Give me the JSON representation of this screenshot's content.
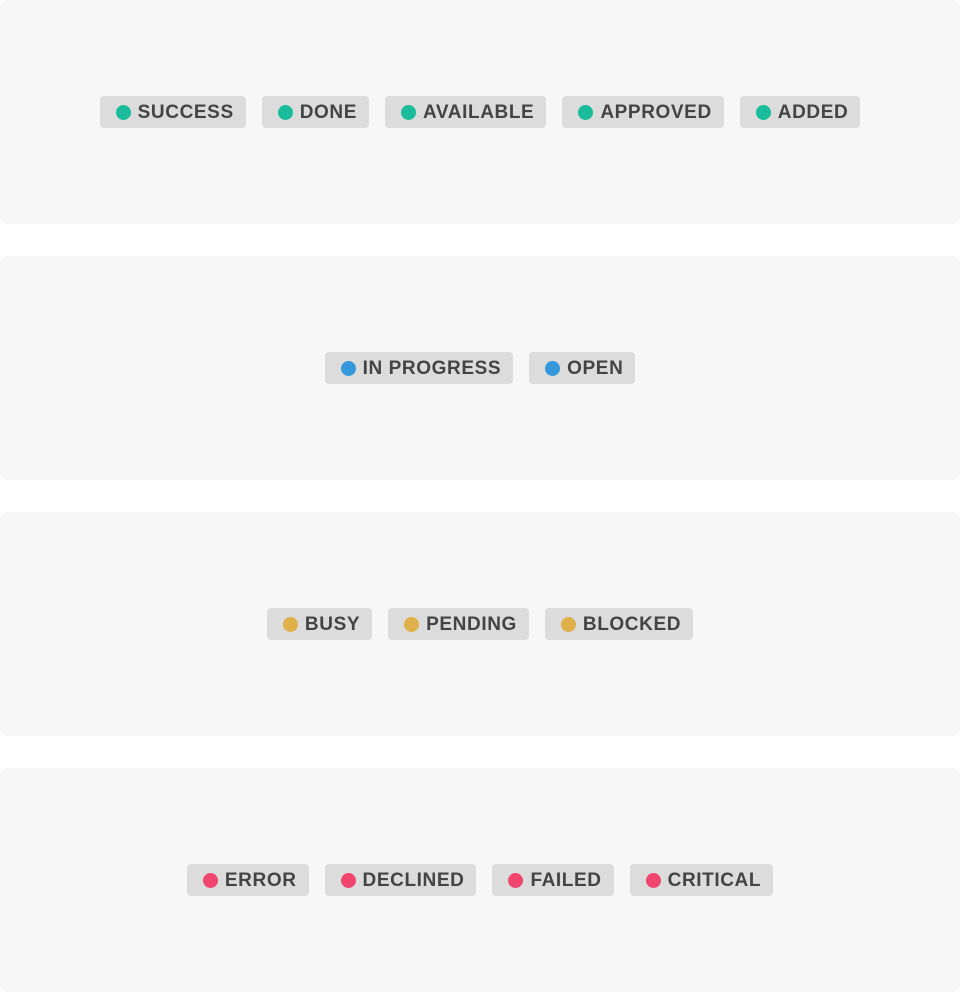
{
  "colors": {
    "success": "#1abc9c",
    "info": "#3498db",
    "warning": "#e0b04a",
    "danger": "#f0456f",
    "badge_background": "#dcdcdc",
    "panel_background": "#f7f7f7",
    "label_text": "#444444"
  },
  "groups": [
    {
      "status": "success",
      "badges": [
        {
          "label": "SUCCESS",
          "icon": "green-dot-icon"
        },
        {
          "label": "DONE",
          "icon": "green-dot-icon"
        },
        {
          "label": "AVAILABLE",
          "icon": "green-dot-icon"
        },
        {
          "label": "APPROVED",
          "icon": "green-dot-icon"
        },
        {
          "label": "ADDED",
          "icon": "green-dot-icon"
        }
      ]
    },
    {
      "status": "info",
      "badges": [
        {
          "label": "IN PROGRESS",
          "icon": "blue-dot-icon"
        },
        {
          "label": "OPEN",
          "icon": "blue-dot-icon"
        }
      ]
    },
    {
      "status": "warning",
      "badges": [
        {
          "label": "BUSY",
          "icon": "yellow-dot-icon"
        },
        {
          "label": "PENDING",
          "icon": "yellow-dot-icon"
        },
        {
          "label": "BLOCKED",
          "icon": "yellow-dot-icon"
        }
      ]
    },
    {
      "status": "danger",
      "badges": [
        {
          "label": "ERROR",
          "icon": "red-dot-icon"
        },
        {
          "label": "DECLINED",
          "icon": "red-dot-icon"
        },
        {
          "label": "FAILED",
          "icon": "red-dot-icon"
        },
        {
          "label": "CRITICAL",
          "icon": "red-dot-icon"
        }
      ]
    }
  ]
}
